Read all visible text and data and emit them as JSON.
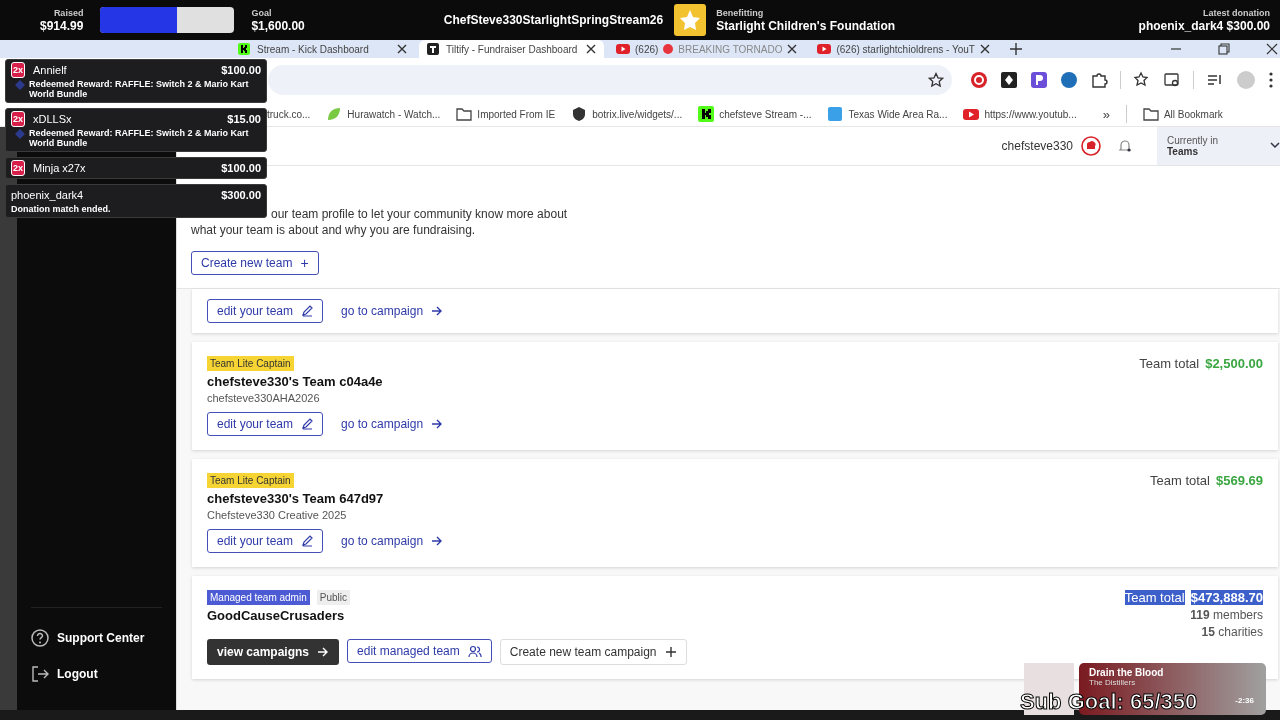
{
  "stream_bar": {
    "raised_label": "Raised",
    "raised": "$914.99",
    "level": 0.572,
    "goal_label": "Goal",
    "goal": "$1,600.00",
    "title": "ChefSteve330StarlightSpringStream26",
    "benefitting_label": "Benefitting",
    "charity": "Starlight Children's Foundation",
    "latest_label": "Latest donation",
    "latest": "phoenix_dark4 $300.00"
  },
  "tabs": [
    {
      "title": "Stream - Kick Dashboard",
      "selected": false
    },
    {
      "title": "Tiltify - Fundraiser Dashboard",
      "selected": true
    },
    {
      "title": "(626)",
      "dot": true,
      "after": "BREAKING TORNADO",
      "selected": false
    },
    {
      "title": "(626) starlightchioldrens - YouT",
      "dot": false,
      "selected": false
    }
  ],
  "bookmarks": [
    "truck.co...",
    "Hurawatch - Watch...",
    "Imported From IE",
    "botrix.live/widgets/...",
    "chefsteve Stream -...",
    "Texas Wide Area Ra...",
    "https://www.youtub..."
  ],
  "bookmarks_more": "»",
  "all_bookmarks": "All Bookmark",
  "sidebar": {
    "items": [
      "Support Center",
      "Logout"
    ]
  },
  "header": {
    "user": "chefsteve330",
    "context_label": "Currently in",
    "context": "Teams"
  },
  "intro": {
    "lines": [
      "our team profile to let your community know more about",
      "what your team is about and why you are fundraising."
    ],
    "create_button": "Create new team",
    "create_icon": "+"
  },
  "teams": [
    {
      "buttons": [
        {
          "kind": "edit",
          "label": "edit your team"
        },
        {
          "kind": "link",
          "label": "go to campaign"
        }
      ]
    },
    {
      "badges": [
        {
          "kind": "captain",
          "label": "Team Lite Captain"
        }
      ],
      "name": "chefsteve330's Team c04a4e",
      "subtitle": "chefsteve330AHA2026",
      "total_label": "Team total",
      "total": "$2,500.00",
      "highlighted": false,
      "buttons": [
        {
          "kind": "edit",
          "label": "edit your team"
        },
        {
          "kind": "link",
          "label": "go to campaign"
        }
      ]
    },
    {
      "badges": [
        {
          "kind": "captain",
          "label": "Team Lite Captain"
        }
      ],
      "name": "chefsteve330's Team 647d97",
      "subtitle": "Chefsteve330 Creative 2025",
      "total_label": "Team total",
      "total": "$569.69",
      "highlighted": false,
      "buttons": [
        {
          "kind": "edit",
          "label": "edit your team"
        },
        {
          "kind": "link",
          "label": "go to campaign"
        }
      ]
    },
    {
      "badges": [
        {
          "kind": "admin",
          "label": "Managed team admin"
        },
        {
          "kind": "public",
          "label": "Public"
        }
      ],
      "name": "GoodCauseCrusaders",
      "total_label": "Team total",
      "total": "$473,888.70",
      "highlighted": true,
      "stats": [
        {
          "count": "119",
          "label": "members"
        },
        {
          "count": "15",
          "label": "charities"
        }
      ],
      "buttons": [
        {
          "kind": "primary",
          "label": "view campaigns"
        },
        {
          "kind": "manage",
          "label": "edit managed team"
        },
        {
          "kind": "create",
          "label": "Create new team campaign"
        }
      ]
    }
  ],
  "alerts": [
    {
      "kind": "reward",
      "multiplier": "2x",
      "name": "Annielf",
      "amount": "$100.00",
      "message": "Redeemed Reward: RAFFLE: Switch 2 & Mario Kart World Bundle"
    },
    {
      "kind": "reward",
      "multiplier": "2x",
      "name": "xDLLSx",
      "amount": "$15.00",
      "message": "Redeemed Reward: RAFFLE: Switch 2 & Mario Kart World Bundle"
    },
    {
      "kind": "plain",
      "multiplier": "2x",
      "name": "Minja x27x",
      "amount": "$100.00"
    },
    {
      "kind": "match",
      "name": "phoenix_dark4",
      "amount": "$300.00",
      "message": "Donation match ended."
    }
  ],
  "now_playing": {
    "track": "Drain the Blood",
    "artist": "The Distillers",
    "remaining": "-2:36",
    "sub_goal": "Sub Goal: 65/350"
  }
}
